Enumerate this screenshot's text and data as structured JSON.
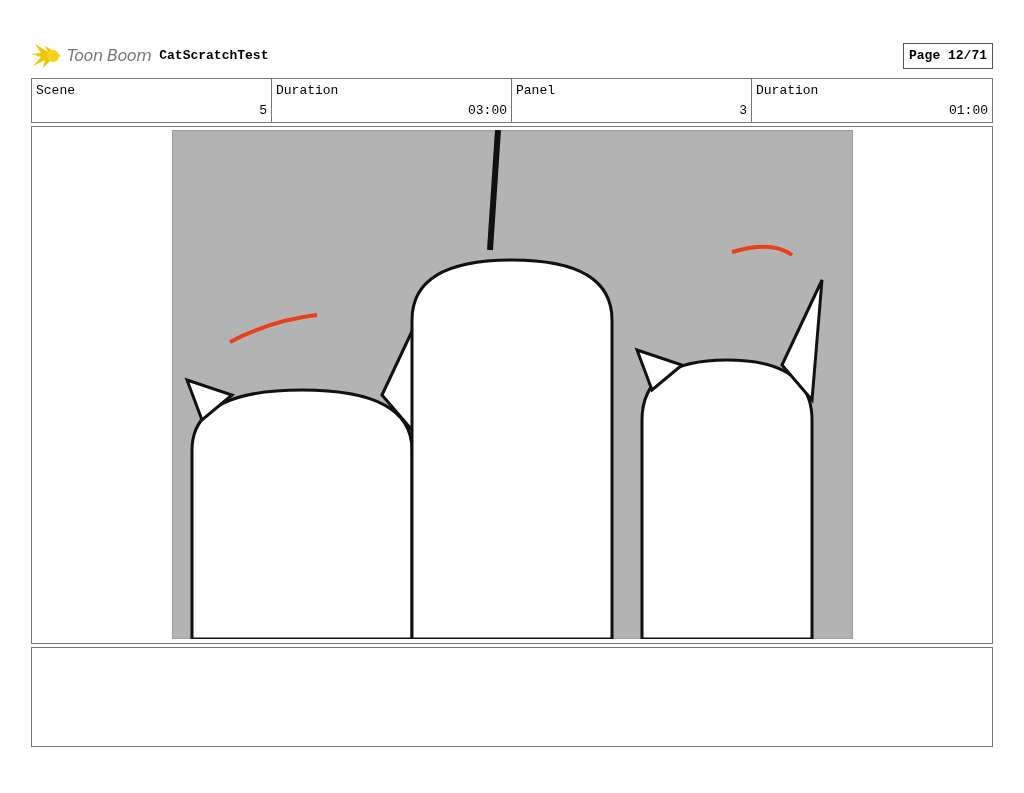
{
  "header": {
    "logo_text": "Toon Boom",
    "project": "CatScratchTest",
    "page": "Page 12/71"
  },
  "info_cells": [
    {
      "heading": "Scene",
      "content": "5"
    },
    {
      "heading": "Duration",
      "content": "03:00"
    },
    {
      "heading": "Panel",
      "content": "3"
    },
    {
      "heading": "Duration",
      "content": "01:00"
    }
  ]
}
